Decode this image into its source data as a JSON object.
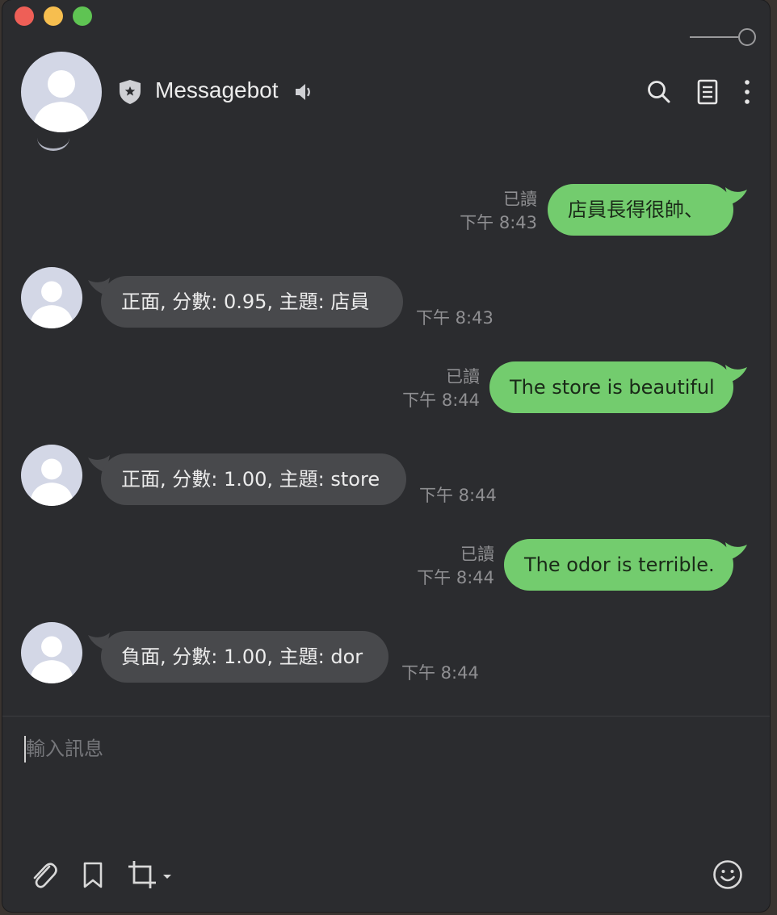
{
  "chat": {
    "title": "Messagebot",
    "icons": {
      "header": [
        "shield-star-icon",
        "speaker-icon",
        "search-icon",
        "notes-icon",
        "more-icon"
      ],
      "toolbar": [
        "paperclip-icon",
        "bookmark-icon",
        "crop-icon",
        "emoji-icon"
      ]
    }
  },
  "messages": [
    {
      "direction": "out",
      "text": "店員長得很帥、",
      "read": "已讀",
      "time": "下午 8:43"
    },
    {
      "direction": "in",
      "text": "正面, 分數: 0.95, 主題: 店員",
      "time": "下午 8:43"
    },
    {
      "direction": "out",
      "text": "The store is beautiful",
      "read": "已讀",
      "time": "下午 8:44"
    },
    {
      "direction": "in",
      "text": "正面, 分數: 1.00, 主題: store",
      "time": "下午 8:44"
    },
    {
      "direction": "out",
      "text": "The odor is terrible.",
      "read": "已讀",
      "time": "下午 8:44"
    },
    {
      "direction": "in",
      "text": "負面, 分數: 1.00, 主題: dor",
      "time": "下午 8:44"
    }
  ],
  "composer": {
    "placeholder": "輸入訊息"
  },
  "colors": {
    "window_bg": "#2b2c2f",
    "incoming_bubble": "#48494c",
    "outgoing_bubble": "#73cc6e",
    "meta_text": "#8f8f92"
  }
}
